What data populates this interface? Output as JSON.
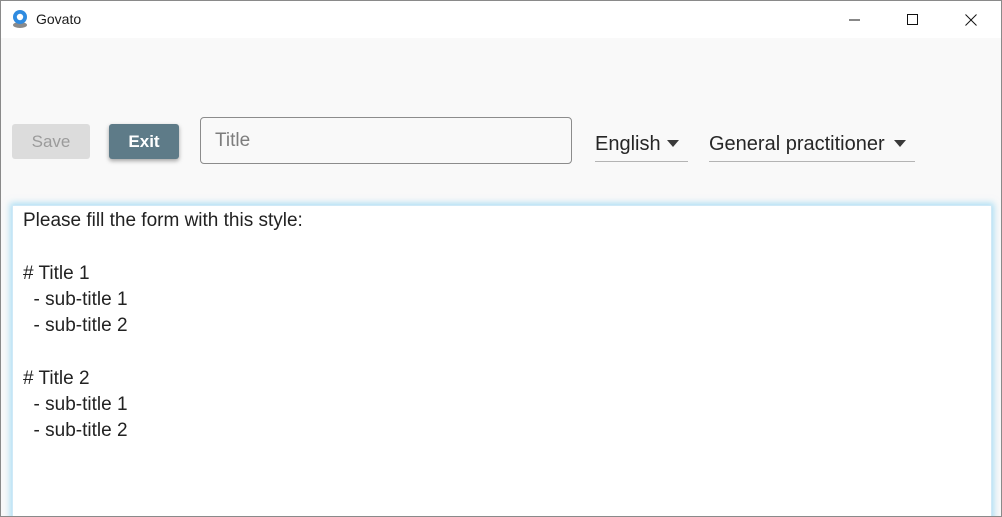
{
  "window": {
    "title": "Govato",
    "controls": [
      "minimize",
      "maximize",
      "close"
    ]
  },
  "toolbar": {
    "save_label": "Save",
    "exit_label": "Exit",
    "title_placeholder": "Title",
    "title_value": "",
    "language": "English",
    "role": "General practitioner"
  },
  "editor": {
    "lines": [
      "Please fill the form with this style:",
      "",
      "# Title 1",
      "  - sub-title 1",
      "  - sub-title 2",
      "",
      "# Title 2",
      "  - sub-title 1",
      "  - sub-title 2"
    ]
  },
  "colors": {
    "accent": "#5e7b88",
    "focus_glow": "#6ec8f0",
    "disabled_bg": "#dcdcdc",
    "app_bg": "#f9f9f9"
  }
}
